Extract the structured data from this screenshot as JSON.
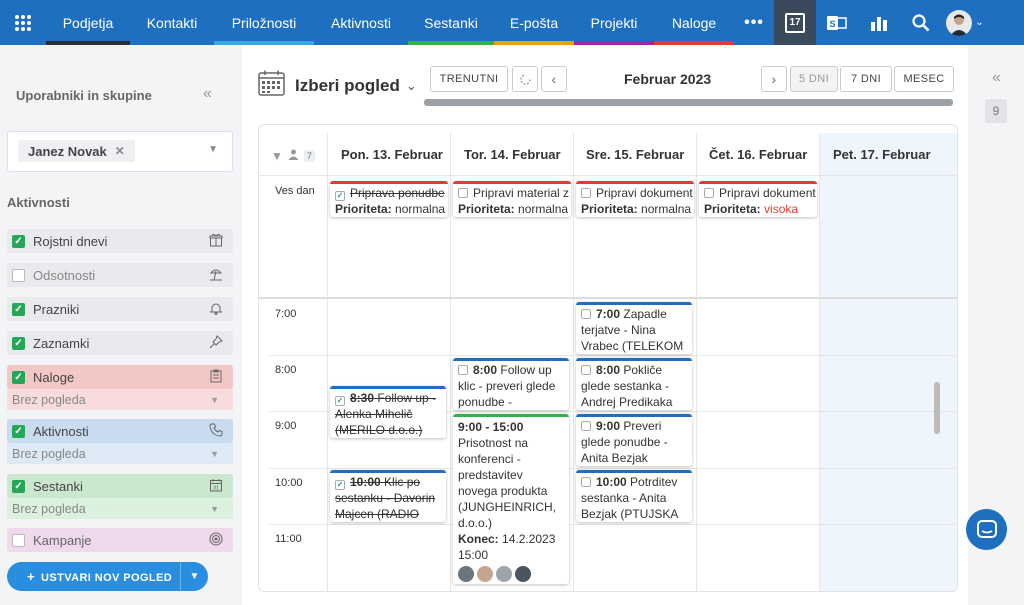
{
  "nav": {
    "items": [
      {
        "label": "Podjetja",
        "bar": "#2a2f38"
      },
      {
        "label": "Kontakti",
        "bar": "#1e6fc0"
      },
      {
        "label": "Priložnosti",
        "bar": "#36a9e1"
      },
      {
        "label": "Aktivnosti",
        "bar": "#1e6fc0"
      },
      {
        "label": "Sestanki",
        "bar": "#2db34a"
      },
      {
        "label": "E-pošta",
        "bar": "#e5a400"
      },
      {
        "label": "Projekti",
        "bar": "#9b27af"
      },
      {
        "label": "Naloge",
        "bar": "#e53935"
      }
    ],
    "more_icon": "more-dots-icon",
    "calendar_badge": "17"
  },
  "left": {
    "title": "Uporabniki in skupine",
    "user_chip": "Janez Novak",
    "activities_title": "Aktivnosti",
    "items": [
      {
        "label": "Rojstni dnevi",
        "checked": true,
        "bg": "#e9eaed",
        "icon": "gift-icon"
      },
      {
        "label": "Odsotnosti",
        "checked": false,
        "bg": "#e9eaed",
        "icon": "beach-icon"
      },
      {
        "label": "Prazniki",
        "checked": true,
        "bg": "#e9eaed",
        "icon": "bell-icon"
      },
      {
        "label": "Zaznamki",
        "checked": true,
        "bg": "#e9eaed",
        "icon": "pin-icon"
      },
      {
        "label": "Naloge",
        "checked": true,
        "bg": "#f4c7c7",
        "icon": "clipboard-icon",
        "sub": "Brez pogleda",
        "subbg": "#f8dcdc"
      },
      {
        "label": "Aktivnosti",
        "checked": true,
        "bg": "#c9dcef",
        "icon": "phone-icon",
        "sub": "Brez pogleda",
        "subbg": "#dde9f4"
      },
      {
        "label": "Sestanki",
        "checked": true,
        "bg": "#cbe8cf",
        "icon": "calendar-icon",
        "sub": "Brez pogleda",
        "subbg": "#dcf0de"
      },
      {
        "label": "Kampanje",
        "checked": false,
        "bg": "#efd9ec",
        "icon": "target-icon"
      }
    ],
    "new_view_label": "USTVARI NOV POGLED"
  },
  "toolbar": {
    "view_title": "Izberi pogled",
    "current_label": "TRENUTNI",
    "month_label": "Februar 2023",
    "five_days": "5 DNI",
    "seven_days": "7 DNI",
    "month": "MESEC"
  },
  "right": {
    "badge": "9"
  },
  "calendar": {
    "people_count": "7",
    "all_day_label": "Ves dan",
    "days": [
      "Pon. 13. Februar",
      "Tor. 14. Februar",
      "Sre. 15. Februar",
      "Čet. 16. Februar",
      "Pet. 17. Februar"
    ],
    "times": [
      "7:00",
      "8:00",
      "9:00",
      "10:00",
      "11:00"
    ],
    "priority_label": "Prioriteta:",
    "allday_events": [
      {
        "title": "Priprava ponudbe",
        "priority": "normalna",
        "done": true
      },
      {
        "title": "Pripravi material z",
        "priority": "normalna",
        "done": false
      },
      {
        "title": "Pripravi dokument",
        "priority": "normalna",
        "done": false
      },
      {
        "title": "Pripravi dokument",
        "priority": "visoka",
        "done": false
      }
    ],
    "events": [
      {
        "time": "7:00",
        "text": "Zapadle terjatve - Nina Vrabec (TELEKOM",
        "done": false
      },
      {
        "time": "8:00",
        "text": "Follow up klic - preveri glede ponudbe -",
        "done": false
      },
      {
        "time": "8:00",
        "text": "Pokliče glede sestanka - Andrej Predikaka",
        "done": false
      },
      {
        "time": "8:30",
        "text": "Follow up - Alenka Mihelič (MERILO d.o.o.)",
        "done": true
      },
      {
        "time": "9:00",
        "text": "Preveri glede ponudbe - Anita Bezjak",
        "done": false
      },
      {
        "time": "10:00",
        "text": "Klic po sestanku - Davorin Majcen (RADIO",
        "done": true
      },
      {
        "time": "10:00",
        "text": "Potrditev sestanka - Anita Bezjak (PTUJSKA",
        "done": false
      }
    ],
    "meeting": {
      "time": "9:00 - 15:00",
      "text": "Prisotnost na konferenci - predstavitev novega produkta (JUNGHEINRICH, d.o.o.)",
      "end_label": "Konec:",
      "end_date": "14.2.2023",
      "end_time": "15:00"
    }
  }
}
